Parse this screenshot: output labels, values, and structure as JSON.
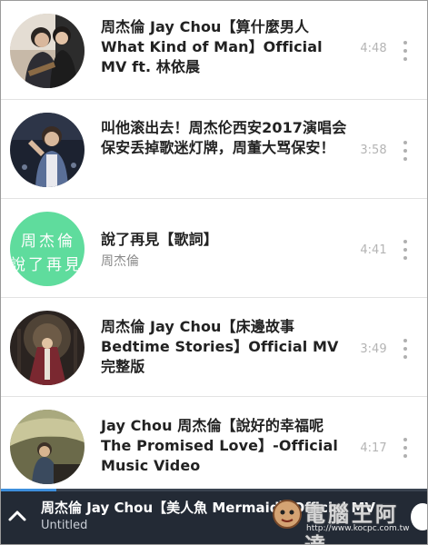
{
  "playlist": [
    {
      "title": "周杰倫 Jay Chou【算什麼男人 What Kind of Man】Official MV ft. 林依晨",
      "artist": "",
      "duration": "4:48",
      "thumb": "couple-photo"
    },
    {
      "title": "叫他滚出去！周杰伦西安2017演唱会保安丢掉歌迷灯牌，周董大骂保安！",
      "artist": "",
      "duration": "3:58",
      "thumb": "concert-photo"
    },
    {
      "title": "說了再見【歌詞】",
      "artist": "周杰倫",
      "duration": "4:41",
      "thumb": "lyrics-card",
      "thumb_text_line1": "周杰倫",
      "thumb_text_line2": "說了再見",
      "thumb_color": "#5fdc9d"
    },
    {
      "title": "周杰倫 Jay Chou【床邊故事 Bedtime Stories】Official MV 完整版",
      "artist": "",
      "duration": "3:49",
      "thumb": "stage-photo"
    },
    {
      "title": "Jay Chou 周杰倫【說好的幸福呢 The Promised Love】-Official Music Video",
      "artist": "",
      "duration": "4:17",
      "thumb": "piano-photo"
    }
  ],
  "player": {
    "now_playing_title": "周杰倫 Jay Chou【美人魚 Mermaid】Official MV",
    "now_playing_subtitle": "Untitled",
    "progress": 0.13,
    "expand_icon": "chevron-up-icon",
    "accent": "#3d8edc",
    "background": "#232a35"
  },
  "watermark": {
    "text": "電腦王阿達",
    "url": "http://www.kocpc.com.tw"
  },
  "icons": {
    "more": "more-vertical-icon"
  }
}
